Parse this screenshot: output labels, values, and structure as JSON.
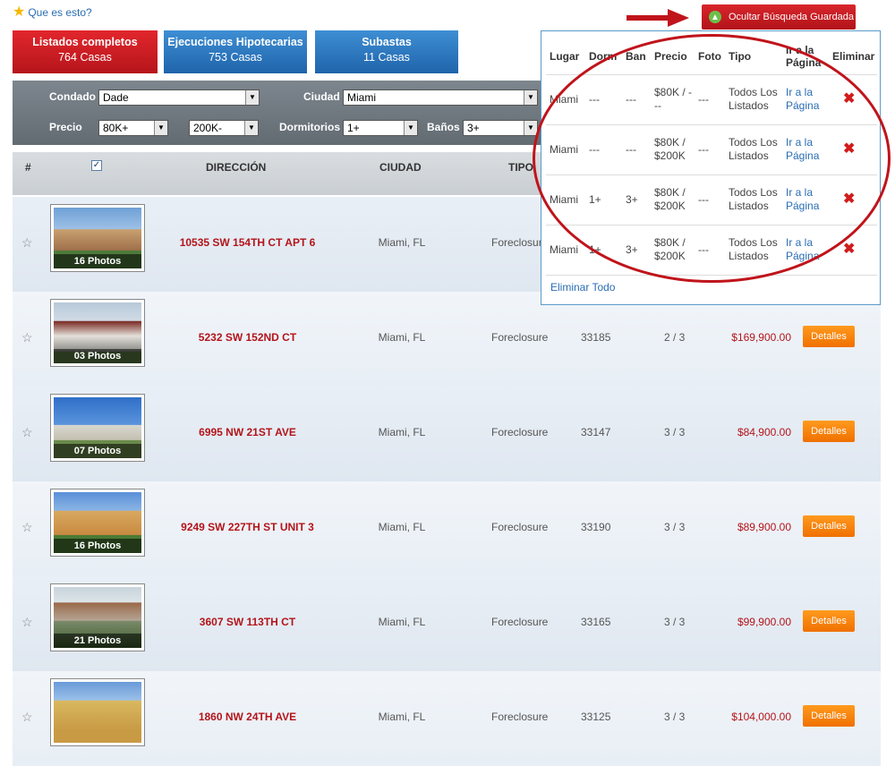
{
  "help_link": "Que es esto?",
  "hide_saved_label": "Ocultar Búsqueda Guardada",
  "tabs": [
    {
      "title": "Listados completos",
      "count": "764 Casas"
    },
    {
      "title": "Ejecuciones Hipotecarias",
      "count": "753 Casas"
    },
    {
      "title": "Subastas",
      "count": "11 Casas"
    }
  ],
  "filters": {
    "condado_label": "Condado",
    "condado_value": "Dade",
    "ciudad_label": "Ciudad",
    "ciudad_value": "Miami",
    "precio_label": "Precio",
    "precio_min": "80K+",
    "precio_max": "200K-",
    "dormitorios_label": "Dormitorios",
    "dormitorios_value": "1+",
    "banos_label": "Baños",
    "banos_value": "3+"
  },
  "table_headers": {
    "num": "#",
    "direccion": "DIRECCIÓN",
    "ciudad": "CIUDAD",
    "tipo": "TIPO"
  },
  "details_label": "Detalles",
  "listings": [
    {
      "photos": "16 Photos",
      "address": "10535 SW 154TH CT APT 6",
      "city": "Miami, FL",
      "type": "Foreclosure",
      "zip": "",
      "bedbath": "",
      "price": ""
    },
    {
      "photos": "03 Photos",
      "address": "5232 SW 152ND CT",
      "city": "Miami, FL",
      "type": "Foreclosure",
      "zip": "33185",
      "bedbath": "2 / 3",
      "price": "$169,900.00"
    },
    {
      "photos": "07 Photos",
      "address": "6995 NW 21ST AVE",
      "city": "Miami, FL",
      "type": "Foreclosure",
      "zip": "33147",
      "bedbath": "3 / 3",
      "price": "$84,900.00"
    },
    {
      "photos": "16 Photos",
      "address": "9249 SW 227TH ST UNIT 3",
      "city": "Miami, FL",
      "type": "Foreclosure",
      "zip": "33190",
      "bedbath": "3 / 3",
      "price": "$89,900.00"
    },
    {
      "photos": "21 Photos",
      "address": "3607 SW 113TH CT",
      "city": "Miami, FL",
      "type": "Foreclosure",
      "zip": "33165",
      "bedbath": "3 / 3",
      "price": "$99,900.00"
    },
    {
      "photos": "",
      "address": "1860 NW 24TH AVE",
      "city": "Miami, FL",
      "type": "Foreclosure",
      "zip": "33125",
      "bedbath": "3 / 3",
      "price": "$104,000.00"
    }
  ],
  "saved": {
    "headers": [
      "Lugar",
      "Dorm",
      "Ban",
      "Precio",
      "Foto",
      "Tipo",
      "Ir a la Página",
      "Eliminar"
    ],
    "rows": [
      {
        "lugar": "Miami",
        "dorm": "---",
        "ban": "---",
        "precio": "$80K / ---",
        "foto": "---",
        "tipo": "Todos Los Listados",
        "link": "Ir a la Página"
      },
      {
        "lugar": "Miami",
        "dorm": "---",
        "ban": "---",
        "precio": "$80K / $200K",
        "foto": "---",
        "tipo": "Todos Los Listados",
        "link": "Ir a la Página"
      },
      {
        "lugar": "Miami",
        "dorm": "1+",
        "ban": "3+",
        "precio": "$80K / $200K",
        "foto": "---",
        "tipo": "Todos Los Listados",
        "link": "Ir a la Página"
      },
      {
        "lugar": "Miami",
        "dorm": "1+",
        "ban": "3+",
        "precio": "$80K / $200K",
        "foto": "---",
        "tipo": "Todos Los Listados",
        "link": "Ir a la Página"
      }
    ],
    "clear_all": "Eliminar Todo"
  }
}
